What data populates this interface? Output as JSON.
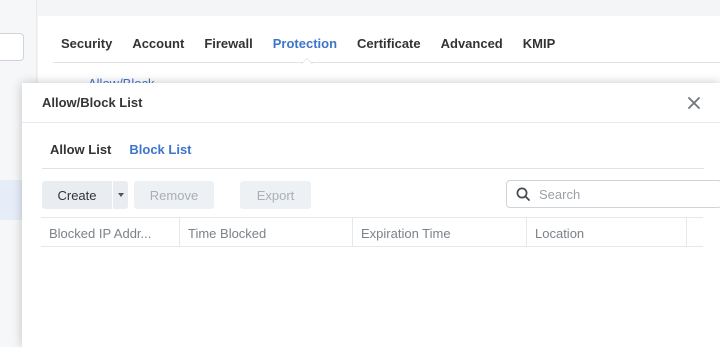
{
  "background": {
    "tabs": [
      {
        "label": "Security"
      },
      {
        "label": "Account"
      },
      {
        "label": "Firewall"
      },
      {
        "label": "Protection",
        "active": true
      },
      {
        "label": "Certificate"
      },
      {
        "label": "Advanced"
      },
      {
        "label": "KMIP"
      }
    ],
    "subtext": "Allow/Block"
  },
  "dialog": {
    "title": "Allow/Block List",
    "tabs": [
      {
        "label": "Allow List"
      },
      {
        "label": "Block List",
        "active": true
      }
    ],
    "toolbar": {
      "create_label": "Create",
      "remove_label": "Remove",
      "export_label": "Export"
    },
    "search": {
      "placeholder": "Search",
      "value": ""
    },
    "table": {
      "columns": [
        "Blocked IP Addr...",
        "Time Blocked",
        "Expiration Time",
        "Location"
      ],
      "rows": []
    }
  },
  "colors": {
    "accent": "#3d75cc",
    "disabled_text": "#a9afb6"
  },
  "icons": {
    "close": "close-icon",
    "search": "search-icon",
    "dropdown": "chevron-down-icon"
  }
}
